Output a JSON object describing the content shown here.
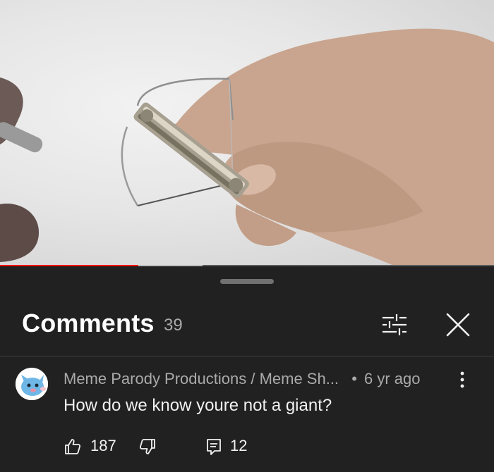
{
  "video": {
    "progress_played": 0.28,
    "progress_buffered": 0.41,
    "colors": {
      "played": "#ff0000",
      "buffered": "#bdbdbd",
      "track": "#5a5a5a"
    }
  },
  "comments_panel": {
    "title": "Comments",
    "count": "39",
    "filter_icon": "sliders-icon",
    "close_icon": "close-icon"
  },
  "comment": {
    "author": "Meme Parody Productions / Meme Sh...",
    "separator": "•",
    "time": "6 yr ago",
    "text": "How do we know youre not a giant?",
    "likes": "187",
    "replies": "12",
    "icons": {
      "like": "thumbs-up-icon",
      "dislike": "thumbs-down-icon",
      "reply": "reply-icon",
      "more": "more-vertical-icon"
    }
  }
}
